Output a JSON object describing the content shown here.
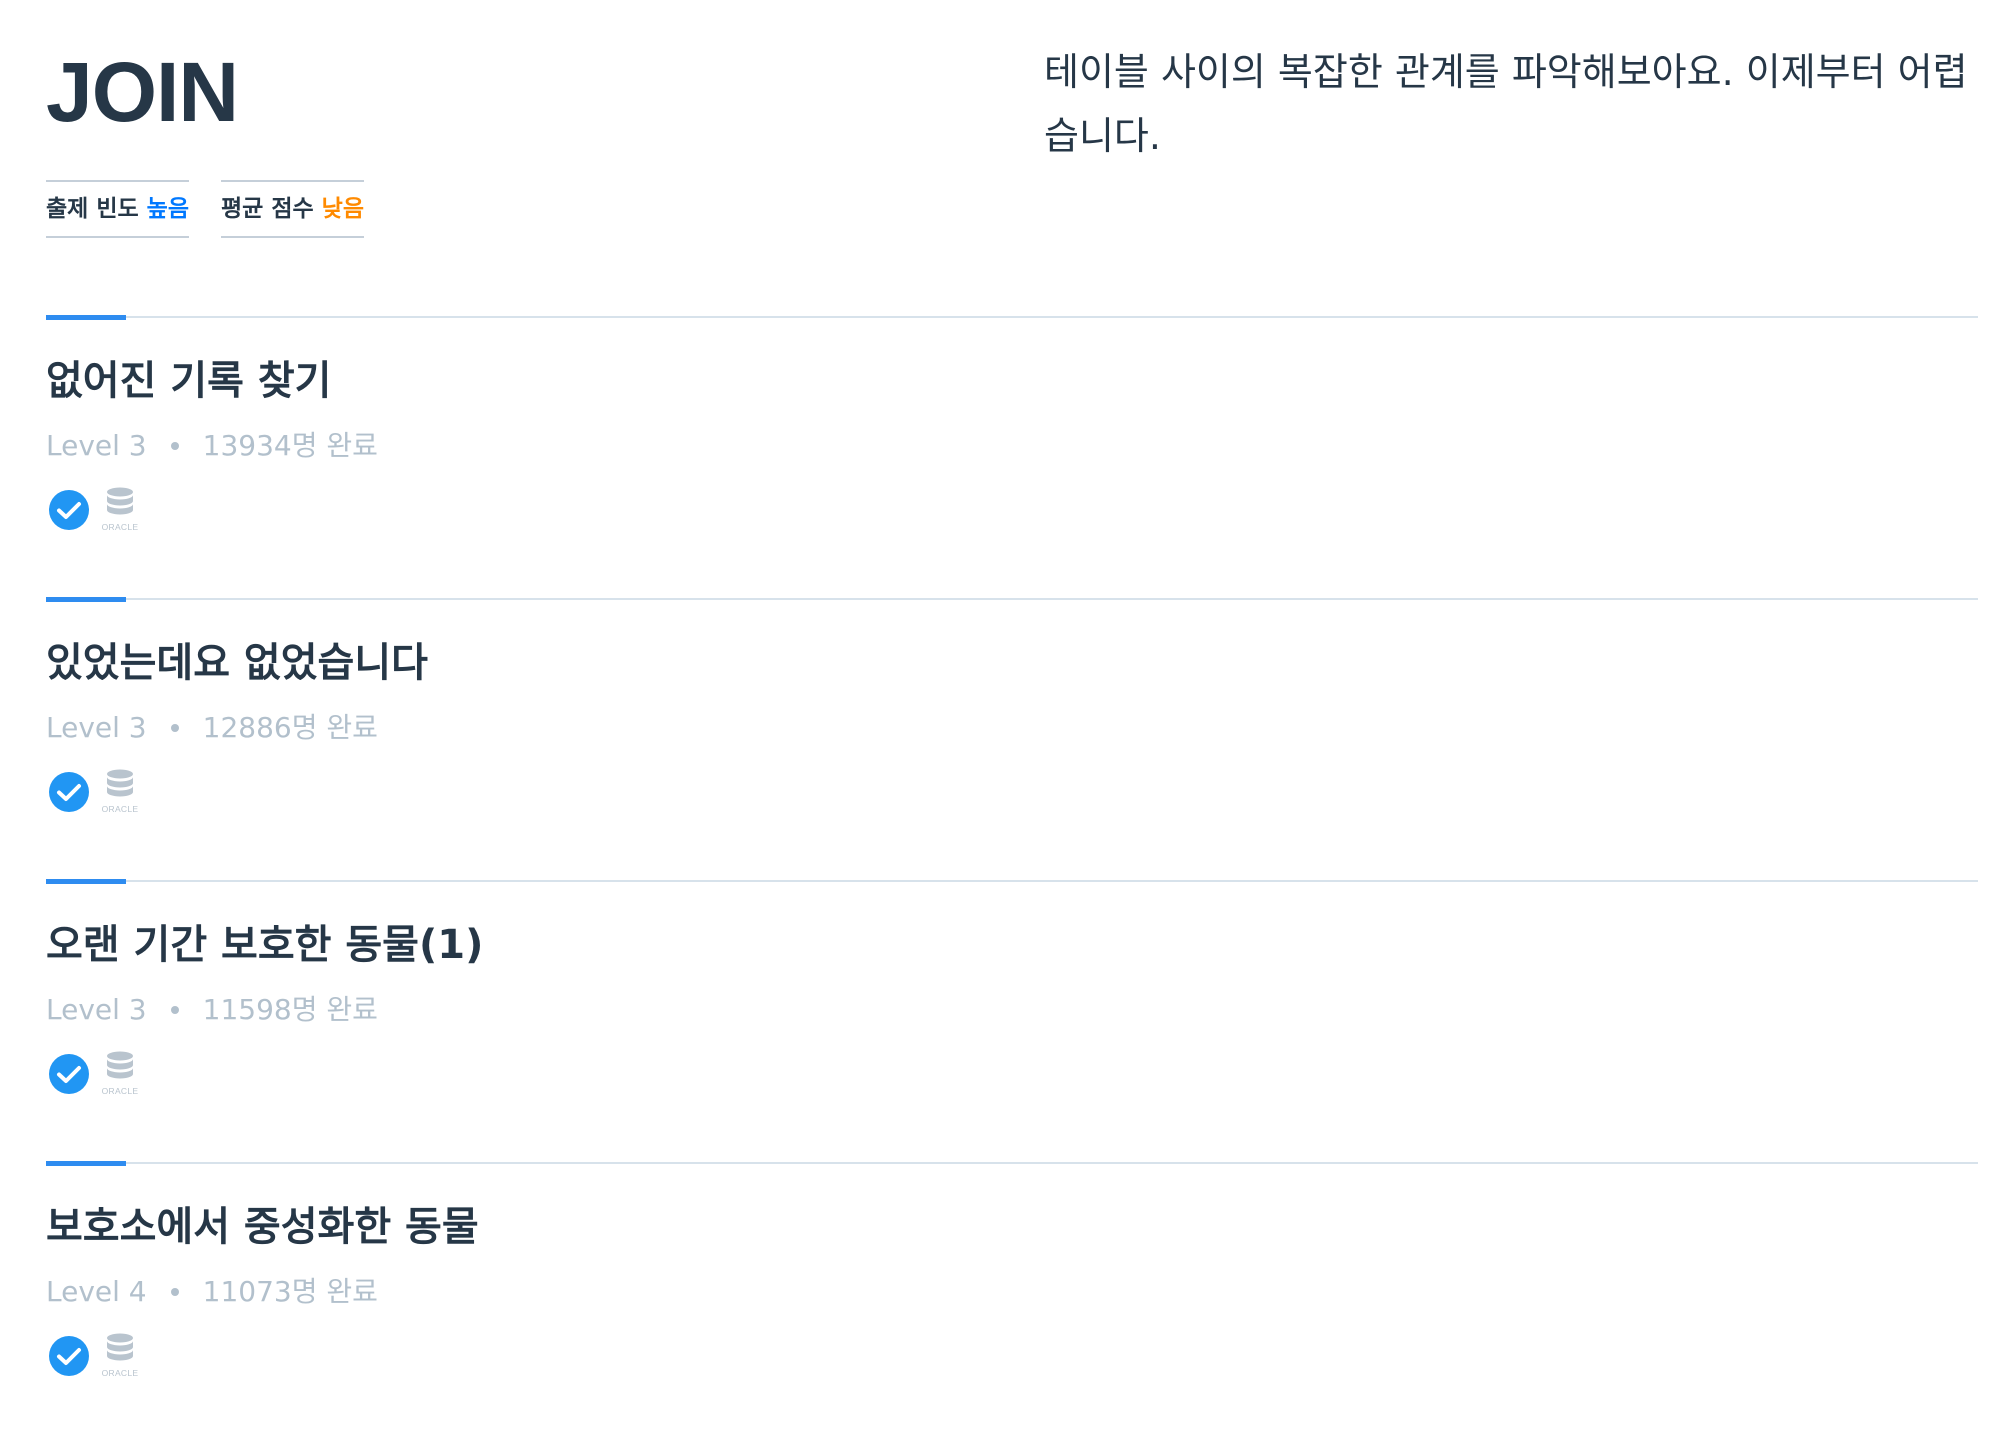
{
  "header": {
    "title": "JOIN",
    "description": "테이블 사이의 복잡한 관계를 파악해보아요. 이제부터 어렵습니다.",
    "tags": [
      {
        "label": "출제 빈도",
        "value": "높음",
        "color": "#0078ff"
      },
      {
        "label": "평균 점수",
        "value": "낮음",
        "color": "#ff8a00"
      }
    ]
  },
  "items": [
    {
      "title": "없어진 기록 찾기",
      "level": "Level 3",
      "completed": "13934명 완료",
      "icons": [
        "check-circle-icon",
        "oracle-database-icon"
      ]
    },
    {
      "title": "있었는데요 없었습니다",
      "level": "Level 3",
      "completed": "12886명 완료",
      "icons": [
        "check-circle-icon",
        "oracle-database-icon"
      ]
    },
    {
      "title": "오랜 기간 보호한 동물(1)",
      "level": "Level 3",
      "completed": "11598명 완료",
      "icons": [
        "check-circle-icon",
        "oracle-database-icon"
      ]
    },
    {
      "title": "보호소에서 중성화한 동물",
      "level": "Level 4",
      "completed": "11073명 완료",
      "icons": [
        "check-circle-icon",
        "oracle-database-icon"
      ]
    }
  ],
  "icon_labels": {
    "oracle": "ORACLE"
  },
  "colors": {
    "accent": "#2e8cf0",
    "text": "#263747",
    "muted": "#b2c0cc",
    "divider": "#d7e2eb"
  }
}
